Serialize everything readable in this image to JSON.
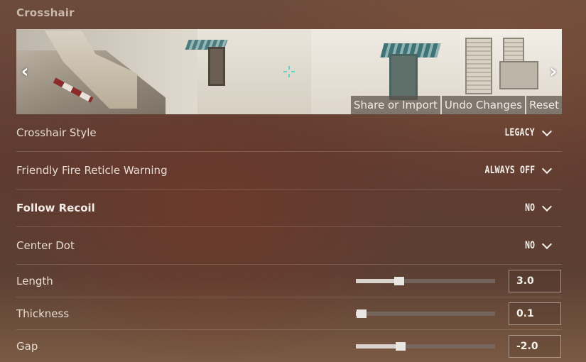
{
  "section_title": "Crosshair",
  "preview": {
    "actions": [
      "Share or Import",
      "Undo Changes",
      "Reset"
    ],
    "prev_icon": "chevron-left-icon",
    "next_icon": "chevron-right-icon",
    "crosshair_color": "#5fd4c4"
  },
  "settings": {
    "crosshair_style": {
      "label": "Crosshair Style",
      "value": "LEGACY"
    },
    "friendly_fire": {
      "label": "Friendly Fire Reticle Warning",
      "value": "ALWAYS OFF"
    },
    "follow_recoil": {
      "label": "Follow Recoil",
      "value": "NO"
    },
    "center_dot": {
      "label": "Center Dot",
      "value": "NO"
    },
    "length": {
      "label": "Length",
      "value": "3.0",
      "slider_fraction": 0.31
    },
    "thickness": {
      "label": "Thickness",
      "value": "0.1",
      "slider_fraction": 0.04
    },
    "gap": {
      "label": "Gap",
      "value": "-2.0",
      "slider_fraction": 0.32
    }
  },
  "colors": {
    "accent": "#5fd4c4",
    "text": "#e6dcd2"
  }
}
